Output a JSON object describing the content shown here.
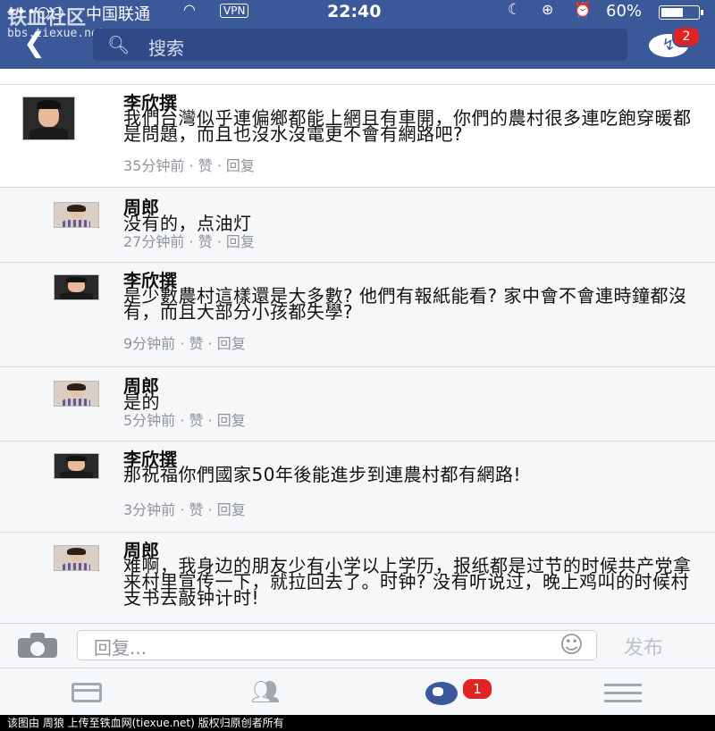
{
  "status_bar": {
    "signal": "•••○○",
    "carrier": "中国联通",
    "vpn": "VPN",
    "time": "22:40",
    "battery_pct": "60%",
    "battery_level": 0.6
  },
  "watermark": {
    "title": "铁血社区",
    "url": "bbs.tiexue.net"
  },
  "header": {
    "back_icon": "chevron-left-icon",
    "search_placeholder": "搜索",
    "messenger_badge": "2"
  },
  "comments": [
    {
      "kind": "main",
      "author": "李欣撰",
      "text": "我們台灣似乎連偏鄉都能上網且有車開，你們的農村很多連吃飽穿暖都是問題，而且也沒水沒電更不會有網路吧?",
      "time": "35分钟前",
      "like": "赞",
      "reply": "回复",
      "avatar": "male"
    },
    {
      "kind": "reply",
      "author": "周郎",
      "text": "没有的，点油灯",
      "time": "27分钟前",
      "like": "赞",
      "reply": "回复",
      "avatar": "female"
    },
    {
      "kind": "reply",
      "author": "李欣撰",
      "text": "是少數農村這樣還是大多數? 他們有報紙能看? 家中會不會連時鐘都沒有，而且大部分小孩都失學?",
      "time": "9分钟前",
      "like": "赞",
      "reply": "回复",
      "avatar": "male"
    },
    {
      "kind": "reply",
      "author": "周郎",
      "text": "是的",
      "time": "5分钟前",
      "like": "赞",
      "reply": "回复",
      "avatar": "female"
    },
    {
      "kind": "reply",
      "author": "李欣撰",
      "text": "那祝福你們國家50年後能進步到連農村都有網路!",
      "time": "3分钟前",
      "like": "赞",
      "reply": "回复",
      "avatar": "male"
    },
    {
      "kind": "reply",
      "author": "周郎",
      "text": "难啊，我身边的朋友少有小学以上学历，报纸都是过节的时候共产党拿来村里宣传一下，就拉回去了。时钟? 没有听说过，晚上鸡叫的时候村支书去敲钟计时!",
      "time": "",
      "like": "",
      "reply": "",
      "avatar": "female"
    }
  ],
  "composer": {
    "placeholder": "回复...",
    "publish": "发布"
  },
  "tabbar": {
    "notification_badge": "1"
  },
  "credit": "该图由 周狼 上传至铁血网(tiexue.net) 版权归原创者所有"
}
